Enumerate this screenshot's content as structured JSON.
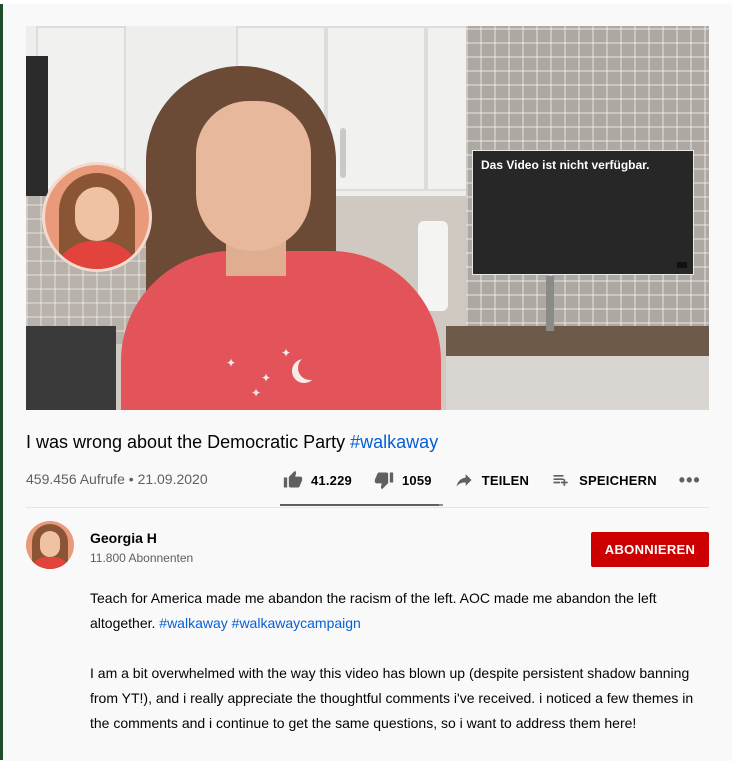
{
  "player": {
    "unavailable_message": "Das Video ist nicht verfügbar."
  },
  "video": {
    "title_text": "I was wrong about the Democratic Party",
    "title_hashtag": "#walkaway",
    "views": "459.456 Aufrufe",
    "separator": " • ",
    "date": "21.09.2020"
  },
  "actions": {
    "likes": "41.229",
    "dislikes": "1059",
    "share_label": "TEILEN",
    "save_label": "SPEICHERN",
    "more_label": "•••",
    "like_ratio": 0.975
  },
  "channel": {
    "name": "Georgia H",
    "subscribers": "11.800 Abonnenten",
    "subscribe_label": "ABONNIEREN"
  },
  "description": {
    "paragraph1_text": "Teach for America made me abandon the racism of the left. AOC made me abandon the left altogether. ",
    "hashtag1": "#walkaway",
    "hashtag2": "#walkawaycampaign",
    "paragraph2": "I am a bit overwhelmed with the way this video has blown up (despite persistent shadow banning from YT!),  and i really appreciate the thoughtful comments i've received. i noticed a few themes in the comments and i continue to get the same questions, so i want to address them here!"
  },
  "colors": {
    "link": "#065fd4",
    "subscribe": "#cc0000",
    "secondary_text": "#606060"
  },
  "icons": [
    "thumb-up-icon",
    "thumb-down-icon",
    "share-icon",
    "playlist-add-icon",
    "more-icon"
  ]
}
